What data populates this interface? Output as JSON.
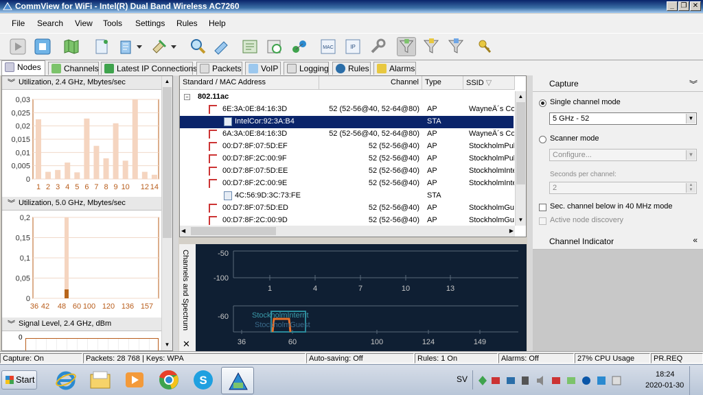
{
  "window": {
    "title": "CommView for WiFi - Intel(R) Dual Band Wireless AC7260"
  },
  "menu": [
    "File",
    "Search",
    "View",
    "Tools",
    "Settings",
    "Rules",
    "Help"
  ],
  "toolbar_icons": [
    "play-icon",
    "stop-icon",
    "map-icon",
    "new-capture-icon",
    "open-file-icon",
    "save-dropdown-icon",
    "plugin-icon",
    "search-icon",
    "packet-generator-icon",
    "reconstruct-icon",
    "logging-timer-icon",
    "nodes-icon",
    "mac-alias-icon",
    "ip-alias-icon",
    "tools-icon",
    "filter-d-icon",
    "filter-m-icon",
    "filter-c-icon",
    "wep-keys-icon"
  ],
  "tabs": [
    "Nodes",
    "Channels",
    "Latest IP Connections",
    "Packets",
    "VoIP",
    "Logging",
    "Rules",
    "Alarms"
  ],
  "left": {
    "section1": "Utilization, 2.4 GHz, Mbytes/sec",
    "section2": "Utilization, 5.0 GHz, Mbytes/sec",
    "section3": "Signal Level, 2.4 GHz, dBm",
    "y1_ticks": [
      "0,03",
      "0,025",
      "0,02",
      "0,015",
      "0,01",
      "0,005",
      "0"
    ],
    "x1_ticks": [
      "1",
      "2",
      "3",
      "4",
      "5",
      "6",
      "7",
      "8",
      "9",
      "10",
      "",
      "12",
      "14"
    ],
    "y2_ticks": [
      "0,2",
      "0,15",
      "0,1",
      "0,05",
      "0"
    ],
    "x2_ticks": [
      "36",
      "42",
      "48",
      "60",
      "100",
      "120",
      "136",
      "157"
    ],
    "y3_tick": "0"
  },
  "nodes": {
    "columns": [
      "Standard / MAC Address",
      "Channel",
      "Type",
      "SSID"
    ],
    "group": "802.11ac",
    "rows": [
      {
        "mac": "6E:3A:0E:84:16:3D",
        "channel": "52 (52-56@40, 52-64@80)",
        "type": "AP",
        "ssid": "WayneÂ´s Co",
        "sel": false,
        "level": 1
      },
      {
        "mac": "IntelCor:92:3A:B4",
        "channel": "",
        "type": "STA",
        "ssid": "",
        "sel": true,
        "level": 2
      },
      {
        "mac": "6A:3A:0E:84:16:3D",
        "channel": "52 (52-56@40, 52-64@80)",
        "type": "AP",
        "ssid": "WayneÂ´s Co",
        "sel": false,
        "level": 1
      },
      {
        "mac": "00:D7:8F:07:5D:EF",
        "channel": "52 (52-56@40)",
        "type": "AP",
        "ssid": "StockholmPub",
        "sel": false,
        "level": 1
      },
      {
        "mac": "00:D7:8F:2C:00:9F",
        "channel": "52 (52-56@40)",
        "type": "AP",
        "ssid": "StockholmPub",
        "sel": false,
        "level": 1
      },
      {
        "mac": "00:D7:8F:07:5D:EE",
        "channel": "52 (52-56@40)",
        "type": "AP",
        "ssid": "StockholmInte",
        "sel": false,
        "level": 1
      },
      {
        "mac": "00:D7:8F:2C:00:9E",
        "channel": "52 (52-56@40)",
        "type": "AP",
        "ssid": "StockholmInte",
        "sel": false,
        "level": 1
      },
      {
        "mac": "4C:56:9D:3C:73:FE",
        "channel": "",
        "type": "STA",
        "ssid": "",
        "sel": false,
        "level": 2
      },
      {
        "mac": "00:D7:8F:07:5D:ED",
        "channel": "52 (52-56@40)",
        "type": "AP",
        "ssid": "StockholmGue",
        "sel": false,
        "level": 1
      },
      {
        "mac": "00:D7:8F:2C:00:9D",
        "channel": "52 (52-56@40)",
        "type": "AP",
        "ssid": "StockholmGue",
        "sel": false,
        "level": 1
      }
    ]
  },
  "spectrum": {
    "side_label": "Channels and Spectrum",
    "top_y": [
      "-50",
      "-100"
    ],
    "top_x": [
      "1",
      "4",
      "7",
      "10",
      "13"
    ],
    "bottom_y": "-60",
    "bottom_x": [
      "36",
      "60",
      "100",
      "124",
      "149"
    ],
    "overlay1": "StockholmInternt",
    "overlay2": "StockholmGuest"
  },
  "capture": {
    "title": "Capture",
    "single_mode": "Single channel mode",
    "channel_value": "5 GHz - 52",
    "scanner_mode": "Scanner mode",
    "configure": "Configure...",
    "seconds_label": "Seconds per channel:",
    "seconds_value": "2",
    "sec_channel": "Sec. channel below in 40 MHz mode",
    "active_discovery": "Active node discovery",
    "channel_indicator": "Channel Indicator"
  },
  "status": {
    "capture": "Capture: On",
    "packets": "Packets: 28 768 | Keys: WPA",
    "autosave": "Auto-saving: Off",
    "rules": "Rules: 1 On",
    "alarms": "Alarms: Off",
    "cpu": "27% CPU Usage",
    "pr": "PR.REQ"
  },
  "taskbar": {
    "start": "Start",
    "lang": "SV",
    "time": "18:24",
    "date": "2020-01-30"
  },
  "colors": {
    "bar": "#f5d5c0",
    "bar_dark": "#b8661b",
    "axis": "#b85c1a",
    "spectrum_bg": "#0f1f33",
    "spectrum_grid": "#5a6a7a",
    "accent": "#0a246a"
  }
}
